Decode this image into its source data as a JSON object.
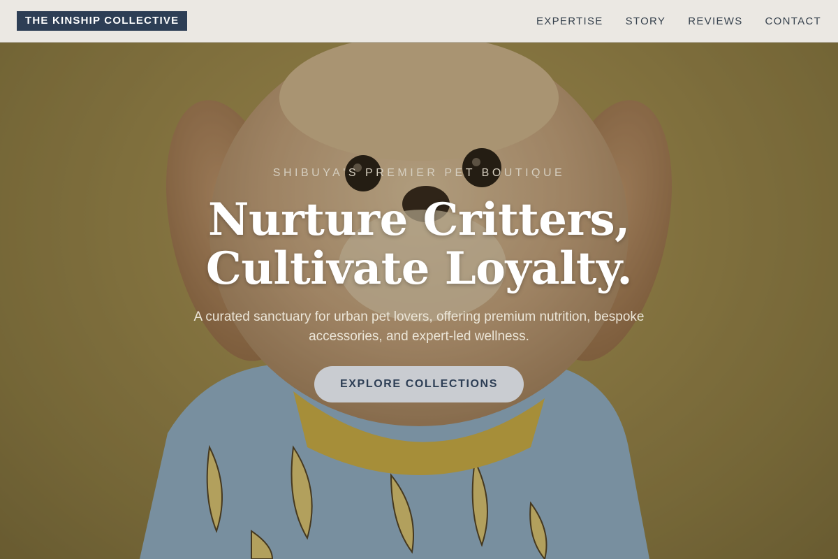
{
  "header": {
    "brand": "THE KINSHIP COLLECTIVE",
    "nav": [
      {
        "label": "EXPERTISE"
      },
      {
        "label": "STORY"
      },
      {
        "label": "REVIEWS"
      },
      {
        "label": "CONTACT"
      }
    ]
  },
  "hero": {
    "eyebrow": "SHIBUYA'S PREMIER PET BOUTIQUE",
    "title_line_1": "Nurture Critters,",
    "title_line_2": "Cultivate Loyalty.",
    "subtitle": "A curated sanctuary for urban pet lovers, offering premium nutrition, bespoke accessories, and expert-led wellness.",
    "cta_label": "EXPLORE COLLECTIONS",
    "background_image": "dog-in-banana-shirt-photo"
  },
  "colors": {
    "brand_navy": "#2d3e55",
    "header_bg": "#ebe8e3",
    "hero_backdrop": "#a38e50",
    "cta_bg": "#c9ccd1"
  }
}
